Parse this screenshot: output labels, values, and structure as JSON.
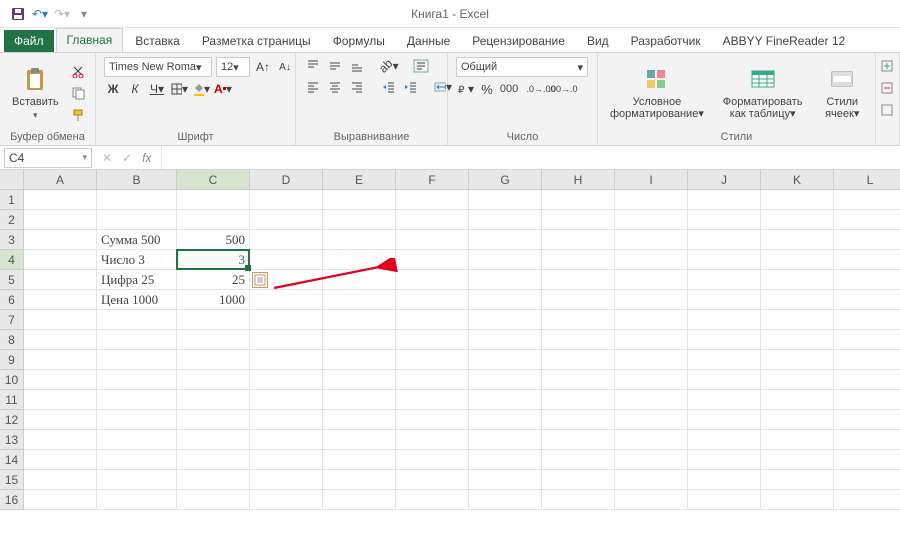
{
  "app": {
    "title": "Книга1 - Excel"
  },
  "qat": {
    "save_tip": "Сохранить",
    "undo_tip": "Отменить",
    "redo_tip": "Вернуть"
  },
  "tabs": {
    "file": "Файл",
    "items": [
      "Главная",
      "Вставка",
      "Разметка страницы",
      "Формулы",
      "Данные",
      "Рецензирование",
      "Вид",
      "Разработчик",
      "ABBYY FineReader 12"
    ],
    "active_index": 0
  },
  "ribbon": {
    "clipboard": {
      "label": "Буфер обмена",
      "paste": "Вставить"
    },
    "font": {
      "label": "Шрифт",
      "name": "Times New Roma",
      "size": "12",
      "bold": "Ж",
      "italic": "К",
      "underline": "Ч"
    },
    "alignment": {
      "label": "Выравнивание"
    },
    "number": {
      "label": "Число",
      "format": "Общий"
    },
    "styles": {
      "label": "Стили",
      "cond": "Условное форматирование",
      "table": "Форматировать как таблицу",
      "cell": "Стили ячеек"
    }
  },
  "formula_bar": {
    "name": "C4",
    "fx": "fx",
    "value": ""
  },
  "sheet": {
    "columns": [
      "A",
      "B",
      "C",
      "D",
      "E",
      "F",
      "G",
      "H",
      "I",
      "J",
      "K",
      "L"
    ],
    "rows_visible": 16,
    "data": {
      "B3": "Сумма 500",
      "C3": "500",
      "B4": "Число 3",
      "C4": "3",
      "B5": "Цифра 25",
      "C5": "25",
      "B6": "Цена 1000",
      "C6": "1000"
    },
    "selected_cell": "C4"
  }
}
